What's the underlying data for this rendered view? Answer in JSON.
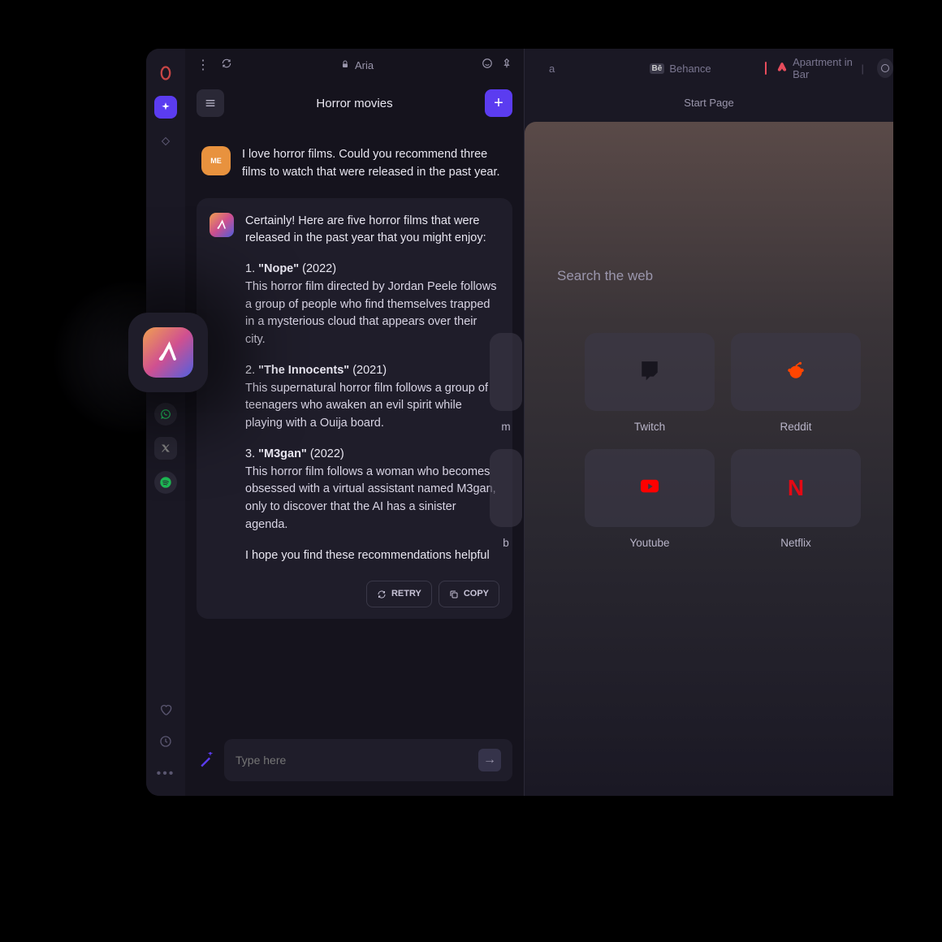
{
  "addressbar": {
    "label": "Aria"
  },
  "aria": {
    "title": "Horror movies",
    "user_avatar": "ME",
    "user_message": "I love horror films. Could you recommend three films to watch that were released in the past year.",
    "ai_intro": "Certainly! Here are five horror films that were released in the past year that you might enjoy:",
    "films": [
      {
        "index": "1.",
        "title": "\"Nope\"",
        "year": "(2022)",
        "desc": "This horror film directed by Jordan Peele follows a group of people who find themselves trapped in a mysterious cloud that appears over their city."
      },
      {
        "index": "2.",
        "title": "\"The Innocents\"",
        "year": "(2021)",
        "desc": "This supernatural horror film follows a group of teenagers who awaken an evil spirit while playing with a Ouija board."
      },
      {
        "index": "3.",
        "title": "\"M3gan\"",
        "year": "(2022)",
        "desc": "This horror film follows a woman who becomes obsessed with a virtual assistant named M3gan, only to discover that the AI has a sinister agenda."
      }
    ],
    "ai_outro": "I hope you find these recommendations helpful",
    "retry_label": "RETRY",
    "copy_label": "COPY",
    "input_placeholder": "Type here"
  },
  "tabs": {
    "behance": "Behance",
    "airbnb": "Apartment in Bar",
    "start_page": "Start Page"
  },
  "start": {
    "search_hint": "Search the web",
    "tiles": [
      {
        "label_partial": "m",
        "icon": "partial"
      },
      {
        "label": "Twitch",
        "icon": "twitch"
      },
      {
        "label": "Reddit",
        "icon": "reddit"
      },
      {
        "label_partial": "b",
        "icon": "partial"
      },
      {
        "label": "Youtube",
        "icon": "youtube"
      },
      {
        "label": "Netflix",
        "icon": "netflix"
      }
    ]
  }
}
